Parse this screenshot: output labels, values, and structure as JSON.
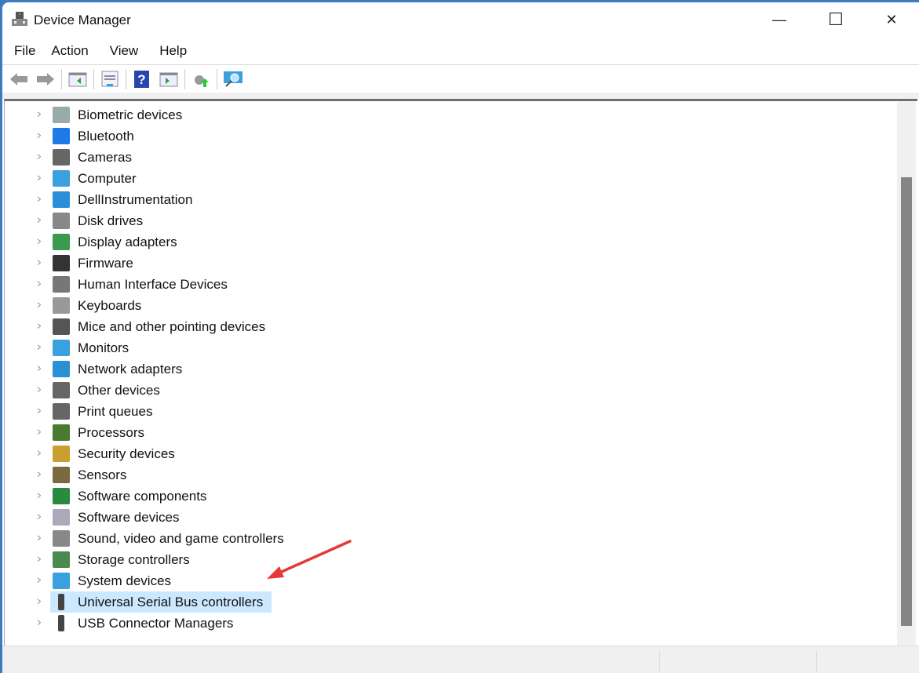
{
  "window": {
    "title": "Device Manager",
    "minimize": "—",
    "maximize": "☐",
    "close": "✕"
  },
  "menu": [
    "File",
    "Action",
    "View",
    "Help"
  ],
  "toolbar": [
    "back-icon",
    "forward-icon",
    "show-hide-console-tree-icon",
    "properties-icon",
    "help-icon",
    "show-action-pane-icon",
    "update-driver-icon",
    "scan-hardware-icon"
  ],
  "tree": {
    "selected_index": 23,
    "items": [
      {
        "label": "Biometric devices",
        "icon": "fingerprint-icon",
        "color": "#9aa"
      },
      {
        "label": "Bluetooth",
        "icon": "bluetooth-icon",
        "color": "#1e7ae6"
      },
      {
        "label": "Cameras",
        "icon": "camera-icon",
        "color": "#666"
      },
      {
        "label": "Computer",
        "icon": "computer-icon",
        "color": "#3aa0e0"
      },
      {
        "label": "DellInstrumentation",
        "icon": "network-icon",
        "color": "#2b8fd8"
      },
      {
        "label": "Disk drives",
        "icon": "disk-icon",
        "color": "#888"
      },
      {
        "label": "Display adapters",
        "icon": "display-adapter-icon",
        "color": "#3a9a50"
      },
      {
        "label": "Firmware",
        "icon": "chip-icon",
        "color": "#333"
      },
      {
        "label": "Human Interface Devices",
        "icon": "hid-icon",
        "color": "#777"
      },
      {
        "label": "Keyboards",
        "icon": "keyboard-icon",
        "color": "#999"
      },
      {
        "label": "Mice and other pointing devices",
        "icon": "mouse-icon",
        "color": "#555"
      },
      {
        "label": "Monitors",
        "icon": "monitor-icon",
        "color": "#3aa0e0"
      },
      {
        "label": "Network adapters",
        "icon": "network-icon",
        "color": "#2b8fd8"
      },
      {
        "label": "Other devices",
        "icon": "unknown-device-icon",
        "color": "#666"
      },
      {
        "label": "Print queues",
        "icon": "printer-icon",
        "color": "#666"
      },
      {
        "label": "Processors",
        "icon": "processor-icon",
        "color": "#4a7a30"
      },
      {
        "label": "Security devices",
        "icon": "security-key-icon",
        "color": "#c9a030"
      },
      {
        "label": "Sensors",
        "icon": "sensor-icon",
        "color": "#7a6a40"
      },
      {
        "label": "Software components",
        "icon": "software-component-icon",
        "color": "#2a8a40"
      },
      {
        "label": "Software devices",
        "icon": "software-device-icon",
        "color": "#aab"
      },
      {
        "label": "Sound, video and game controllers",
        "icon": "speaker-icon",
        "color": "#888"
      },
      {
        "label": "Storage controllers",
        "icon": "storage-controller-icon",
        "color": "#4a8a50"
      },
      {
        "label": "System devices",
        "icon": "system-devices-icon",
        "color": "#3aa0e0"
      },
      {
        "label": "Universal Serial Bus controllers",
        "icon": "usb-icon",
        "color": "#444"
      },
      {
        "label": "USB Connector Managers",
        "icon": "usb-icon",
        "color": "#444"
      }
    ]
  },
  "annotation_color": "#e53935"
}
